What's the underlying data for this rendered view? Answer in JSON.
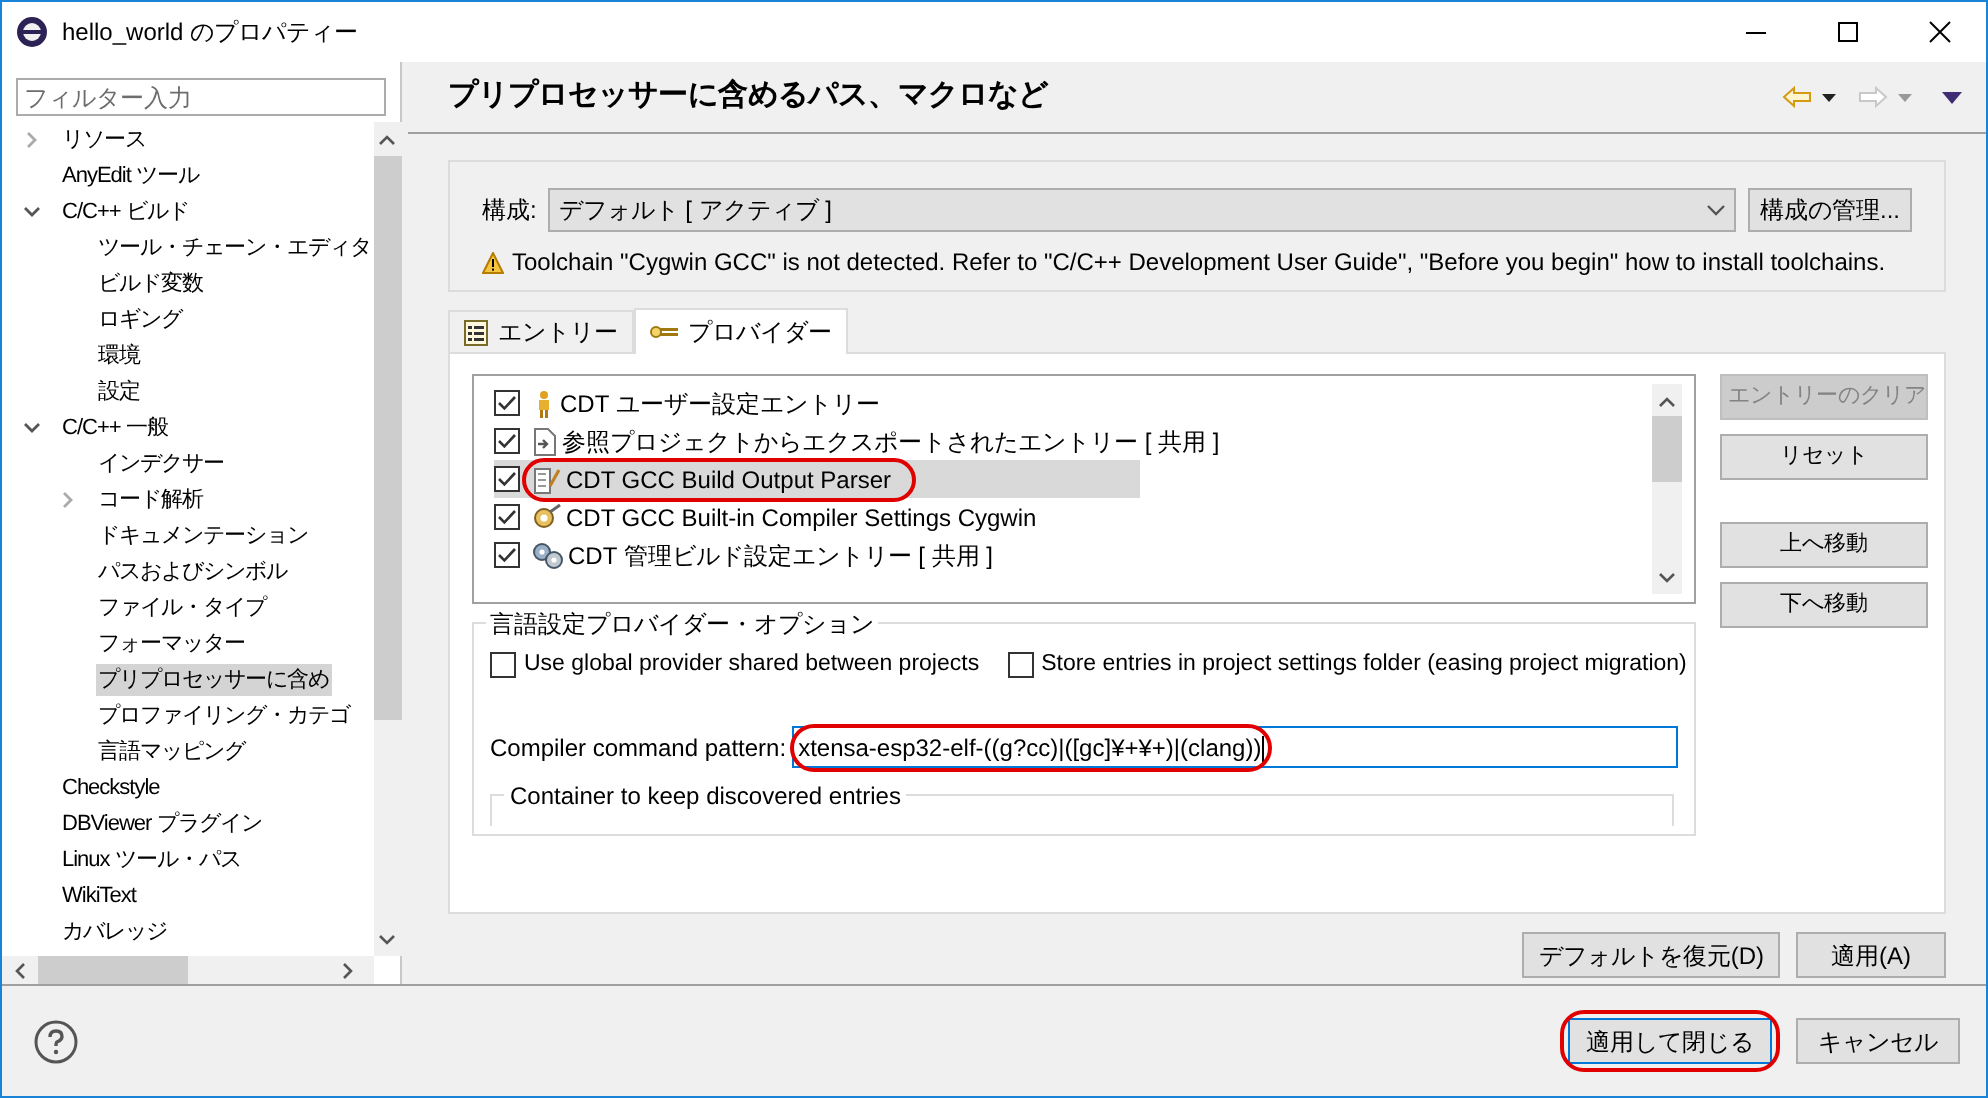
{
  "window": {
    "title": "hello_world のプロパティー"
  },
  "sidebar": {
    "filter": {
      "placeholder": "フィルター入力"
    },
    "tree": [
      {
        "label": "リソース",
        "expanded": false,
        "selected": false
      },
      {
        "label": "AnyEdit ツール",
        "selected": false
      },
      {
        "label": "C/C++ ビルド",
        "expanded": true,
        "selected": false,
        "children": [
          {
            "label": "ツール・チェーン・エディタ",
            "selected": false
          },
          {
            "label": "ビルド変数",
            "selected": false
          },
          {
            "label": "ロギング",
            "selected": false
          },
          {
            "label": "環境",
            "selected": false
          },
          {
            "label": "設定",
            "selected": false
          }
        ]
      },
      {
        "label": "C/C++ 一般",
        "expanded": true,
        "selected": false,
        "children": [
          {
            "label": "インデクサー",
            "selected": false
          },
          {
            "label": "コード解析",
            "expanded": false,
            "selected": false
          },
          {
            "label": "ドキュメンテーション",
            "selected": false
          },
          {
            "label": "パスおよびシンボル",
            "selected": false
          },
          {
            "label": "ファイル・タイプ",
            "selected": false
          },
          {
            "label": "フォーマッター",
            "selected": false
          },
          {
            "label": "プリプロセッサーに含め",
            "selected": true
          },
          {
            "label": "プロファイリング・カテゴ",
            "selected": false
          },
          {
            "label": "言語マッピング",
            "selected": false
          }
        ]
      },
      {
        "label": "Checkstyle",
        "selected": false
      },
      {
        "label": "DBViewer プラグイン",
        "selected": false
      },
      {
        "label": "Linux ツール・パス",
        "selected": false
      },
      {
        "label": "WikiText",
        "selected": false
      },
      {
        "label": "カバレッジ",
        "selected": false
      }
    ]
  },
  "page": {
    "title": "プリプロセッサーに含めるパス、マクロなど"
  },
  "configuration": {
    "label": "構成:",
    "value": "デフォルト [ アクティブ ]",
    "manage_button": "構成の管理...",
    "warning": "Toolchain \"Cygwin GCC\" is not detected. Refer to \"C/C++ Development User Guide\", \"Before you begin\" how to install toolchains."
  },
  "tabs": [
    {
      "label": "エントリー",
      "kind": "entries",
      "selected": false
    },
    {
      "label": "プロバイダー",
      "kind": "providers",
      "selected": true
    }
  ],
  "providers": [
    {
      "label": "CDT ユーザー設定エントリー",
      "kind": "user",
      "checked": true,
      "selected": false,
      "highlighted": false
    },
    {
      "label": "参照プロジェクトからエクスポートされたエントリー [ 共用 ]",
      "kind": "export",
      "checked": true,
      "selected": false,
      "highlighted": false
    },
    {
      "label": "CDT GCC Build Output Parser",
      "kind": "parser",
      "checked": true,
      "selected": true,
      "highlighted": true
    },
    {
      "label": "CDT GCC Built-in Compiler Settings Cygwin",
      "kind": "builtin",
      "checked": true,
      "selected": false,
      "highlighted": false
    },
    {
      "label": "CDT 管理ビルド設定エントリー [ 共用 ]",
      "kind": "managed",
      "checked": true,
      "selected": false,
      "highlighted": false
    }
  ],
  "provider_buttons": [
    {
      "label": "エントリーのクリア",
      "disabled": true
    },
    {
      "label": "リセット",
      "disabled": false
    },
    {
      "label": "上へ移動",
      "disabled": false
    },
    {
      "label": "下へ移動",
      "disabled": false
    }
  ],
  "options": {
    "title": "言語設定プロバイダー・オプション",
    "checkboxes": [
      {
        "label": "Use global provider shared between projects",
        "checked": false
      },
      {
        "label": "Store entries in project settings folder (easing project migration)",
        "checked": false
      }
    ],
    "pattern": {
      "label": "Compiler command pattern:",
      "value": "xtensa-esp32-elf-((g?cc)|([gc]¥+¥+)|(clang))",
      "highlighted": true
    },
    "container_title": "Container to keep discovered entries"
  },
  "page_buttons": [
    "デフォルトを復元(D)",
    "適用(A)"
  ],
  "dialog_buttons": [
    {
      "label": "適用して閉じる",
      "highlighted": true
    },
    {
      "label": "キャンセル",
      "highlighted": false
    }
  ]
}
